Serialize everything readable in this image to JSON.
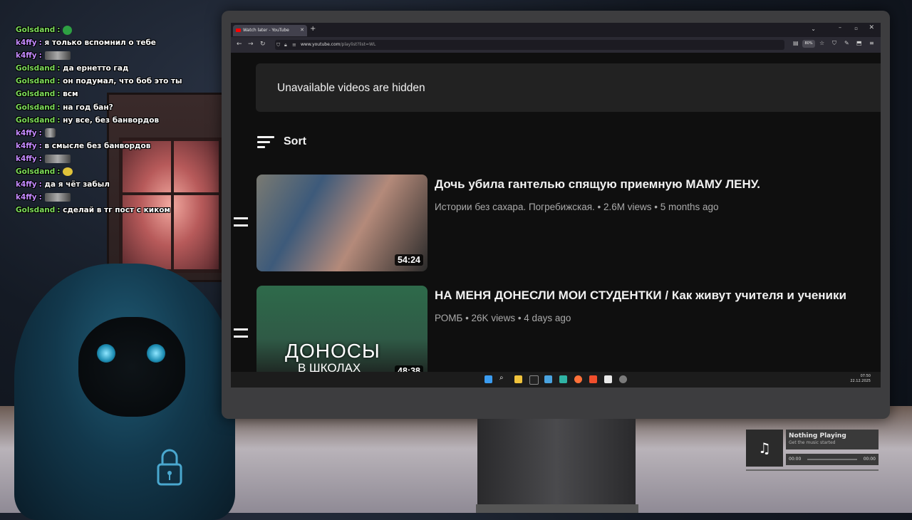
{
  "chat": {
    "messages": [
      {
        "user": "Golsdand",
        "user_color": "#7ddc5a",
        "text": "",
        "emote": "green"
      },
      {
        "user": "k4ffy",
        "user_color": "#c48aff",
        "text": "я только вспомнил о тебе",
        "emote": ""
      },
      {
        "user": "k4ffy",
        "user_color": "#c48aff",
        "text": "",
        "emote": "wide"
      },
      {
        "user": "Golsdand",
        "user_color": "#7ddc5a",
        "text": "да ернетто гад",
        "emote": ""
      },
      {
        "user": "Golsdand",
        "user_color": "#7ddc5a",
        "text": "он подумал, что боб это ты",
        "emote": ""
      },
      {
        "user": "Golsdand",
        "user_color": "#7ddc5a",
        "text": "всм",
        "emote": ""
      },
      {
        "user": "Golsdand",
        "user_color": "#7ddc5a",
        "text": "на год бан?",
        "emote": ""
      },
      {
        "user": "Golsdand",
        "user_color": "#7ddc5a",
        "text": "ну все, без банвордов",
        "emote": ""
      },
      {
        "user": "k4ffy",
        "user_color": "#c48aff",
        "text": "",
        "emote": "small"
      },
      {
        "user": "k4ffy",
        "user_color": "#c48aff",
        "text": "в смысле без банвордов",
        "emote": ""
      },
      {
        "user": "k4ffy",
        "user_color": "#c48aff",
        "text": "",
        "emote": "wide"
      },
      {
        "user": "Golsdand",
        "user_color": "#7ddc5a",
        "text": "",
        "emote": "yellow"
      },
      {
        "user": "k4ffy",
        "user_color": "#c48aff",
        "text": "да я чёт забыл",
        "emote": ""
      },
      {
        "user": "k4ffy",
        "user_color": "#c48aff",
        "text": "",
        "emote": "wide"
      },
      {
        "user": "Golsdand",
        "user_color": "#7ddc5a",
        "text": "сделай в тг пост с киком",
        "emote": ""
      }
    ]
  },
  "browser": {
    "tab_title": "Watch later - YouTube",
    "url_host": "www.youtube.com",
    "url_path": "/playlist?list=WL",
    "zoom": "80%"
  },
  "page": {
    "notice": "Unavailable videos are hidden",
    "sort_label": "Sort",
    "videos": [
      {
        "title": "Дочь убила гантелью спящую приемную МАМУ ЛЕНУ.",
        "meta": "Истории без сахара. Погребижская. • 2.6M views • 5 months ago",
        "duration": "54:24",
        "thumb_text": ""
      },
      {
        "title": "НА МЕНЯ ДОНЕСЛИ МОИ СТУДЕНТКИ / Как живут учителя и ученики",
        "meta": "РОМБ • 26K views • 4 days ago",
        "duration": "48:38",
        "thumb_text": "ДОНОСЫ",
        "thumb_sub": "В ШКОЛАХ"
      }
    ]
  },
  "taskbar": {
    "time": "07:50",
    "date": "22.12.2025"
  },
  "music": {
    "title": "Nothing Playing",
    "subtitle": "Get the music started",
    "elapsed": "00:00",
    "total": "00:00"
  }
}
